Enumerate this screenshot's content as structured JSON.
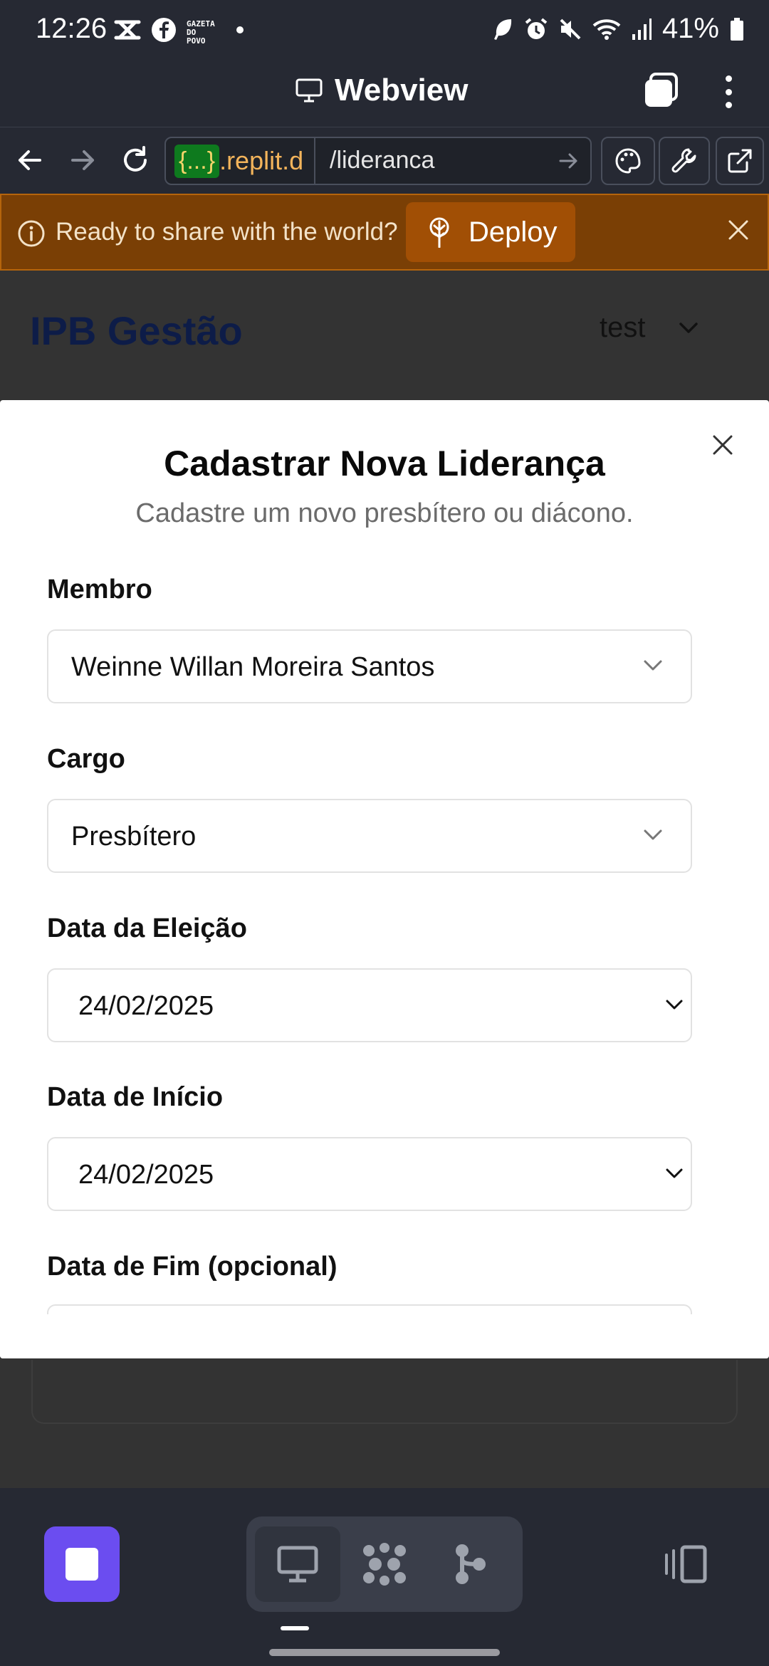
{
  "status_bar": {
    "time": "12:26",
    "gazeta_line1": "GAZETA",
    "gazeta_line2": "DO POVO",
    "battery": "41%"
  },
  "app_bar": {
    "title": "Webview",
    "title_icon": "monitor-icon",
    "tabs_icon": "tabs-icon",
    "more_icon": "more-vertical-icon"
  },
  "url_bar": {
    "repl_badge": "{...}",
    "host": ".replit.d",
    "path": "/lideranca"
  },
  "banner": {
    "text": "Ready to share with the world?",
    "deploy_label": "Deploy",
    "color": "#7a3f05"
  },
  "page": {
    "brand": "IPB Gestão",
    "user": "test"
  },
  "modal": {
    "title": "Cadastrar Nova Liderança",
    "subtitle": "Cadastre um novo presbítero ou diácono.",
    "fields": [
      {
        "label": "Membro",
        "value": "Weinne Willan Moreira Santos"
      },
      {
        "label": "Cargo",
        "value": "Presbítero"
      },
      {
        "label": "Data da Eleição",
        "value": "24/02/2025"
      },
      {
        "label": "Data de Início",
        "value": "24/02/2025"
      },
      {
        "label": "Data de Fim (opcional)",
        "value": ""
      }
    ]
  },
  "bottom_nav": {
    "accent": "#6b4df0"
  }
}
